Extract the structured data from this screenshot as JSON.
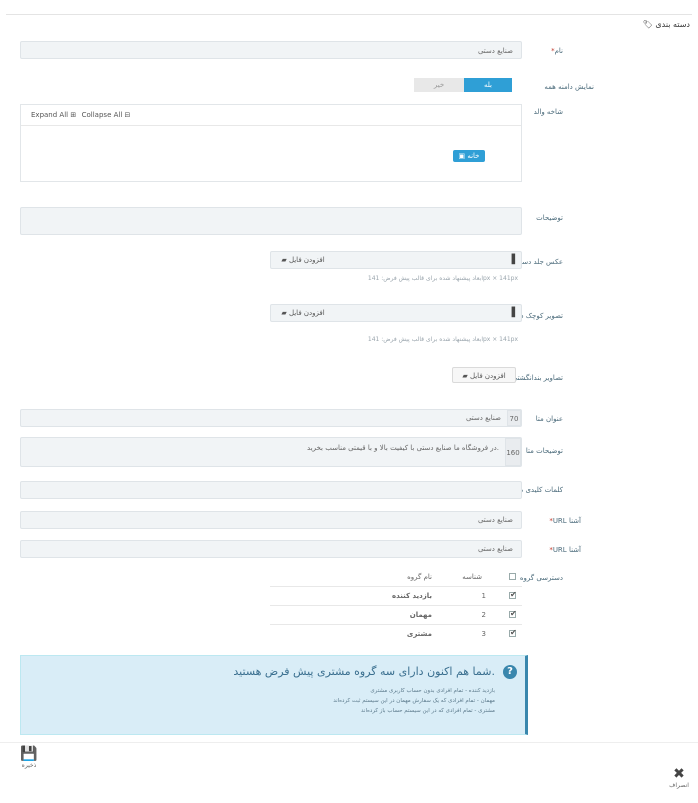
{
  "header": {
    "title": "دسته بندی",
    "tag_icon": "tag-icon"
  },
  "form": {
    "name": {
      "label": "نام",
      "value": "صنایع دستی"
    },
    "show_subcategory": {
      "label": "نمایش دامنه همه",
      "on": "بله",
      "off": "خیر"
    },
    "parent": {
      "label": "شاخه والد",
      "expand_all": "Expand All",
      "collapse_all": "Collapse All",
      "root_button": "خانه"
    },
    "description": {
      "label": "توضیحات",
      "value": ""
    },
    "category_image": {
      "label": "عکس جلد دسته بندی",
      "button": "افزودن فایل",
      "hint": "ابعاد پیشنهاد شده برای قالب پیش فرض: 141px × 141px"
    },
    "thumbnail": {
      "label": "تصویر کوچک دسته بندی",
      "button": "افزودن فایل",
      "hint": "ابعاد پیشنهاد شده برای قالب پیش فرض: 141px × 141px"
    },
    "menu_thumbnail": {
      "label": "تصاویر بندانگشتی منو",
      "button": "افزودن فایل"
    },
    "meta_title": {
      "label": "عنوان متا",
      "addon": "70",
      "value": "صنایع دستی"
    },
    "meta_description": {
      "label": "توضیحات متا",
      "addon": "160",
      "value": "در فروشگاه ما صنایع دستی با کیفیت بالا و با قیمتی مناسب بخرید."
    },
    "meta_keywords": {
      "label": "کلمات کلیدی متا",
      "value": ""
    },
    "friendly_url": {
      "label": "URL آشنا",
      "value": "صنایع دستی"
    },
    "simple_url": {
      "label": "URL آشنا",
      "value": "صنایع دستی"
    },
    "group_access": {
      "label": "دسترسی گروه",
      "header": {
        "id": "شناسه",
        "name": "نام گروه"
      },
      "rows": [
        {
          "id": "1",
          "name": "بازدید کننده",
          "checked": true
        },
        {
          "id": "2",
          "name": "مهمان",
          "checked": true
        },
        {
          "id": "3",
          "name": "مشتری",
          "checked": true
        }
      ]
    }
  },
  "info": {
    "title": "شما هم اکنون دارای سه گروه مشتری پیش فرض هستید.",
    "lines": [
      "بازدید کننده - تمام افرادی بدون حساب کاربری مشتری",
      "مهمان - تمام افرادی که یک سفارش مهمان در این سیستم ثبت کرده‌اند",
      "مشتری - تمام افرادی که در این سیستم حساب باز کرده‌اند"
    ]
  },
  "footer": {
    "save": "ذخیره",
    "cancel": "انصراف"
  }
}
